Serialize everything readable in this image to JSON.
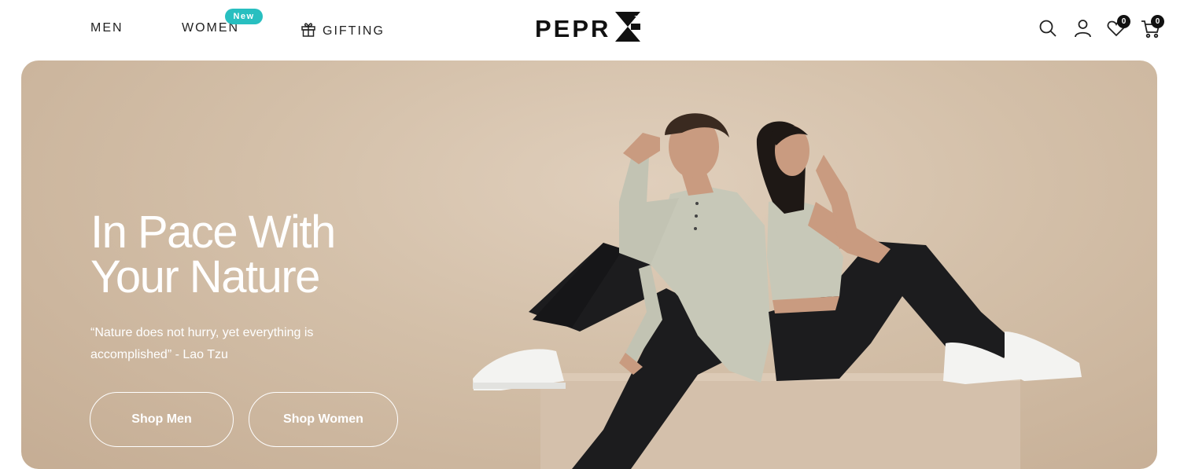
{
  "header": {
    "nav": {
      "men": "MEN",
      "women": "WOMEN",
      "women_badge": "New",
      "gifting": "GIFTING"
    },
    "logo_text": "PEPR",
    "wishlist_count": "0",
    "cart_count": "0"
  },
  "hero": {
    "title": "In Pace With\nYour Nature",
    "quote": "“Nature does not hurry, yet everything is accomplished” - Lao Tzu",
    "buttons": {
      "shop_men": "Shop Men",
      "shop_women": "Shop Women"
    }
  },
  "icons": [
    "gift-icon",
    "pepr-logo-mark",
    "search-icon",
    "user-icon",
    "heart-icon",
    "cart-icon"
  ],
  "colors": {
    "badge_new": "#28bfc0",
    "hero_bg": "#d3bfa8",
    "text_dark": "#222222",
    "white": "#ffffff"
  }
}
